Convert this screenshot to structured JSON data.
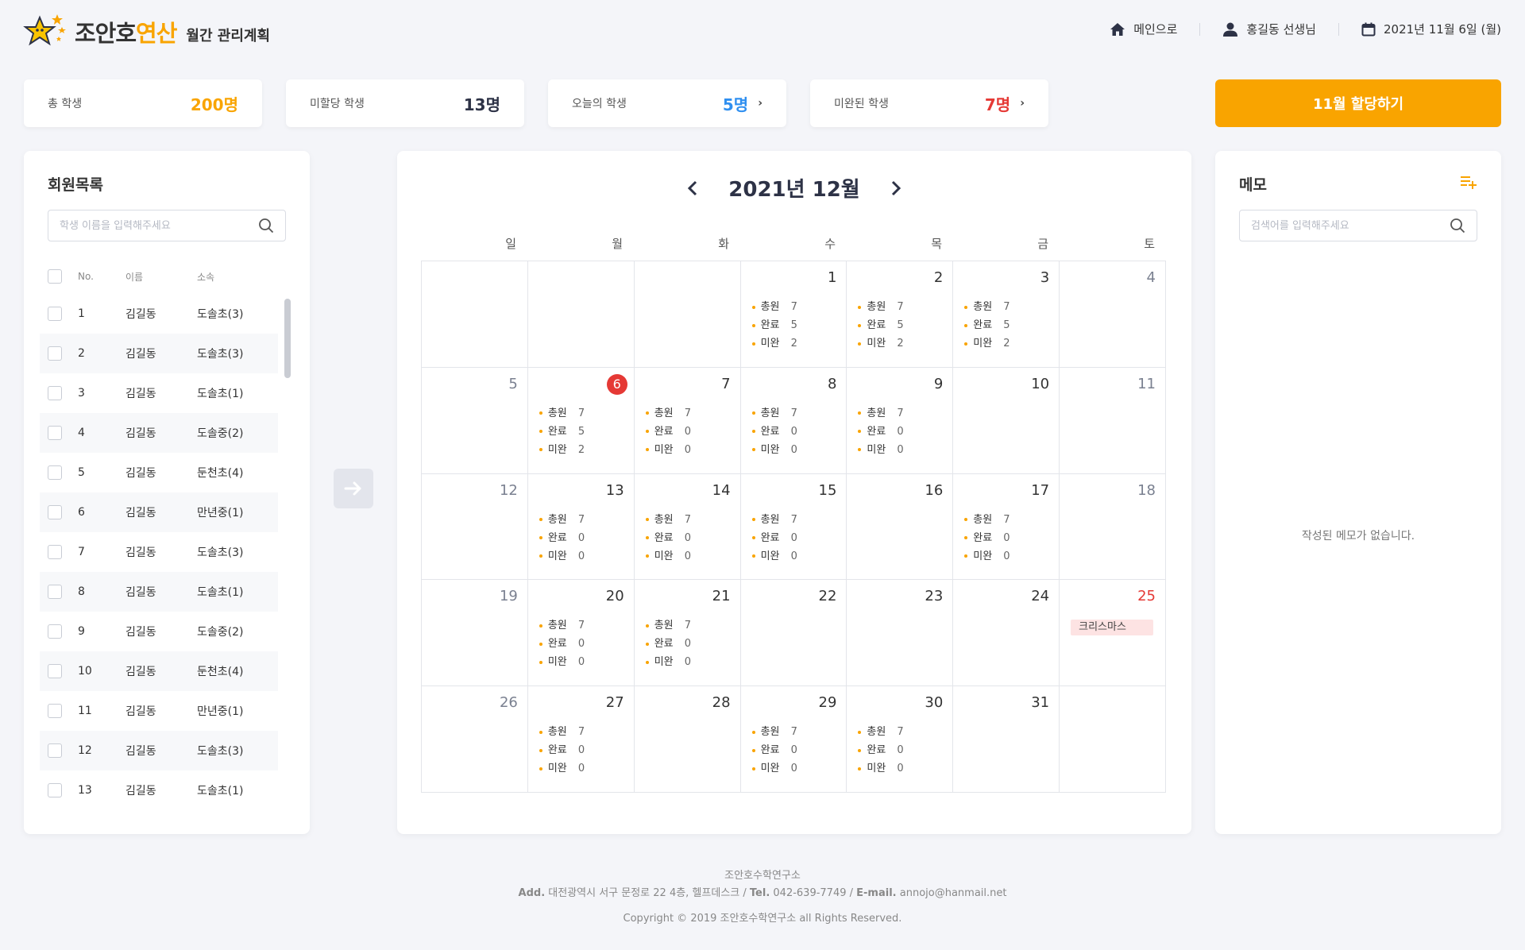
{
  "header": {
    "logo_text_a": "조안호",
    "logo_text_b": "연산",
    "subtitle": "월간 관리계획",
    "nav_home": "메인으로",
    "nav_user": "홍길동 선생님",
    "nav_date": "2021년 11월 6일 (월)"
  },
  "stats": {
    "total_label": "총 학생",
    "total_value": "200명",
    "unassigned_label": "미할당 학생",
    "unassigned_value": "13명",
    "today_label": "오늘의 학생",
    "today_value": "5명",
    "incomplete_label": "미완된 학생",
    "incomplete_value": "7명",
    "assign_button": "11월 할당하기"
  },
  "colors": {
    "accent": "#f9a400",
    "blue": "#2f8ff0",
    "red": "#e53935",
    "dark": "#2d3246"
  },
  "members": {
    "title": "회원목록",
    "search_placeholder": "학생 이름을 입력해주세요",
    "columns": {
      "no": "No.",
      "name": "이름",
      "org": "소속"
    },
    "rows": [
      {
        "no": "1",
        "name": "김길동",
        "org": "도솔초(3)"
      },
      {
        "no": "2",
        "name": "김길동",
        "org": "도솔초(3)"
      },
      {
        "no": "3",
        "name": "김길동",
        "org": "도솔초(1)"
      },
      {
        "no": "4",
        "name": "김길동",
        "org": "도솔중(2)"
      },
      {
        "no": "5",
        "name": "김길동",
        "org": "둔천초(4)"
      },
      {
        "no": "6",
        "name": "김길동",
        "org": "만년중(1)"
      },
      {
        "no": "7",
        "name": "김길동",
        "org": "도솔초(3)"
      },
      {
        "no": "8",
        "name": "김길동",
        "org": "도솔초(1)"
      },
      {
        "no": "9",
        "name": "김길동",
        "org": "도솔중(2)"
      },
      {
        "no": "10",
        "name": "김길동",
        "org": "둔천초(4)"
      },
      {
        "no": "11",
        "name": "김길동",
        "org": "만년중(1)"
      },
      {
        "no": "12",
        "name": "김길동",
        "org": "도솔초(3)"
      },
      {
        "no": "13",
        "name": "김길동",
        "org": "도솔초(1)"
      }
    ]
  },
  "calendar": {
    "title": "2021년 12월",
    "weekdays": [
      "일",
      "월",
      "화",
      "수",
      "목",
      "금",
      "토"
    ],
    "stat_labels": {
      "total": "총원",
      "done": "완료",
      "pending": "미완"
    },
    "cells": [
      {},
      {},
      {},
      {
        "day": "1",
        "stats": [
          "7",
          "5",
          "2"
        ]
      },
      {
        "day": "2",
        "stats": [
          "7",
          "5",
          "2"
        ]
      },
      {
        "day": "3",
        "stats": [
          "7",
          "5",
          "2"
        ]
      },
      {
        "day": "4"
      },
      {
        "day": "5"
      },
      {
        "day": "6",
        "today": true,
        "stats": [
          "7",
          "5",
          "2"
        ]
      },
      {
        "day": "7",
        "stats": [
          "7",
          "0",
          "0"
        ]
      },
      {
        "day": "8",
        "stats": [
          "7",
          "0",
          "0"
        ]
      },
      {
        "day": "9",
        "stats": [
          "7",
          "0",
          "0"
        ]
      },
      {
        "day": "10"
      },
      {
        "day": "11"
      },
      {
        "day": "12"
      },
      {
        "day": "13",
        "stats": [
          "7",
          "0",
          "0"
        ]
      },
      {
        "day": "14",
        "stats": [
          "7",
          "0",
          "0"
        ]
      },
      {
        "day": "15",
        "stats": [
          "7",
          "0",
          "0"
        ]
      },
      {
        "day": "16"
      },
      {
        "day": "17",
        "stats": [
          "7",
          "0",
          "0"
        ]
      },
      {
        "day": "18"
      },
      {
        "day": "19"
      },
      {
        "day": "20",
        "stats": [
          "7",
          "0",
          "0"
        ]
      },
      {
        "day": "21",
        "stats": [
          "7",
          "0",
          "0"
        ]
      },
      {
        "day": "22"
      },
      {
        "day": "23"
      },
      {
        "day": "24"
      },
      {
        "day": "25",
        "holiday": true,
        "event": "크리스마스"
      },
      {
        "day": "26"
      },
      {
        "day": "27",
        "stats": [
          "7",
          "0",
          "0"
        ]
      },
      {
        "day": "28"
      },
      {
        "day": "29",
        "stats": [
          "7",
          "0",
          "0"
        ]
      },
      {
        "day": "30",
        "stats": [
          "7",
          "0",
          "0"
        ]
      },
      {
        "day": "31"
      },
      {}
    ]
  },
  "memo": {
    "title": "메모",
    "search_placeholder": "검색어를 입력해주세요",
    "empty_text": "작성된 메모가 없습니다."
  },
  "footer": {
    "org": "조안호수학연구소",
    "add_label": "Add.",
    "address": "대전광역시 서구 문정로 22 4층, 헬프데스크",
    "tel_label": "Tel.",
    "tel": "042-639-7749",
    "email_label": "E-mail.",
    "email": "annojo@hanmail.net",
    "copyright": "Copyright © 2019 조안호수학연구소 all Rights Reserved."
  }
}
